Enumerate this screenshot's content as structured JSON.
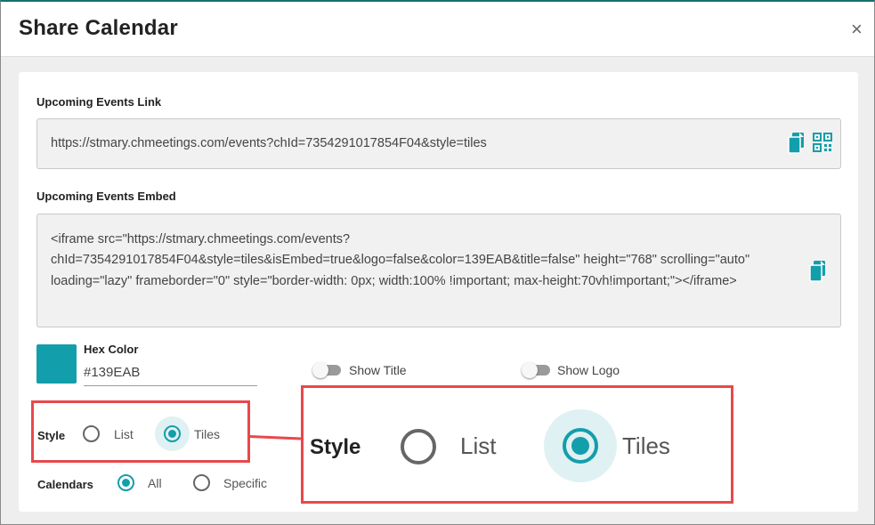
{
  "dialog": {
    "title": "Share Calendar",
    "close_glyph": "×"
  },
  "events_link": {
    "label": "Upcoming Events Link",
    "value": "https://stmary.chmeetings.com/events?chId=7354291017854F04&style=tiles",
    "icons": [
      "copy-icon",
      "qr-code-icon"
    ]
  },
  "events_embed": {
    "label": "Upcoming Events Embed",
    "value": "<iframe src=\"https://stmary.chmeetings.com/events?chId=7354291017854F04&style=tiles&isEmbed=true&logo=false&color=139EAB&title=false\" height=\"768\" scrolling=\"auto\" loading=\"lazy\" frameborder=\"0\" style=\"border-width: 0px; width:100% !important; max-height:70vh!important;\"></iframe>",
    "icons": [
      "copy-icon"
    ]
  },
  "color": {
    "label": "Hex Color",
    "value": "#139EAB",
    "swatch": "#139EAB"
  },
  "toggles": [
    {
      "label": "Show Title",
      "on": false
    },
    {
      "label": "Show Logo",
      "on": false
    }
  ],
  "style": {
    "label": "Style",
    "options": [
      "List",
      "Tiles"
    ],
    "selected": "Tiles"
  },
  "calendars": {
    "label": "Calendars",
    "options": [
      "All",
      "Specific"
    ],
    "selected": "All"
  },
  "zoom_callout": {
    "label": "Style",
    "options": [
      "List",
      "Tiles"
    ],
    "selected": "Tiles"
  },
  "colors": {
    "accent": "#139EAB",
    "highlight": "#e8484b",
    "header_rule": "#17706e"
  }
}
